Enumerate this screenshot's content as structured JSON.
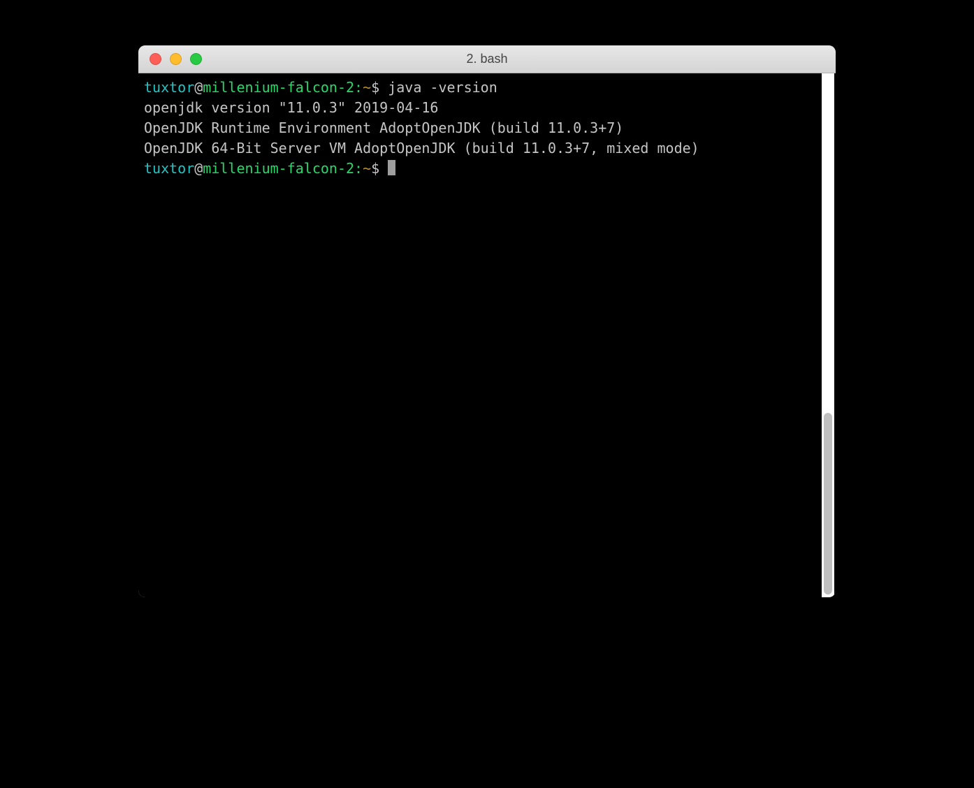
{
  "window": {
    "title": "2. bash"
  },
  "prompt": {
    "user": "tuxtor",
    "at": "@",
    "host": "millenium-falcon-2",
    "sep": ":",
    "tilde": "~",
    "dollar": "$"
  },
  "lines": {
    "command1": " java -version",
    "output1": "openjdk version \"11.0.3\" 2019-04-16",
    "output2": "OpenJDK Runtime Environment AdoptOpenJDK (build 11.0.3+7)",
    "output3": "OpenJDK 64-Bit Server VM AdoptOpenJDK (build 11.0.3+7, mixed mode)"
  }
}
